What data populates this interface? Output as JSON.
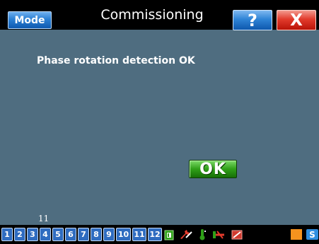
{
  "header": {
    "mode_label": "Mode",
    "title": "Commissioning",
    "help_label": "?",
    "close_label": "X"
  },
  "main": {
    "message": "Phase rotation detection OK",
    "ok_label": "OK",
    "counter": "11"
  },
  "statusbar": {
    "tabs": [
      "1",
      "2",
      "3",
      "4",
      "5",
      "6",
      "7",
      "8",
      "9",
      "10",
      "11",
      "12"
    ],
    "icons": [
      "door-open-icon",
      "wrench-icon",
      "thermometer-icon",
      "cable-warning-icon",
      "disconnect-icon",
      "orange-square-icon",
      "s-icon"
    ],
    "colors": {
      "tab_blue": "#2f6cc0",
      "green": "#2fa018",
      "red": "#e23b2c",
      "orange": "#f6931e"
    }
  }
}
